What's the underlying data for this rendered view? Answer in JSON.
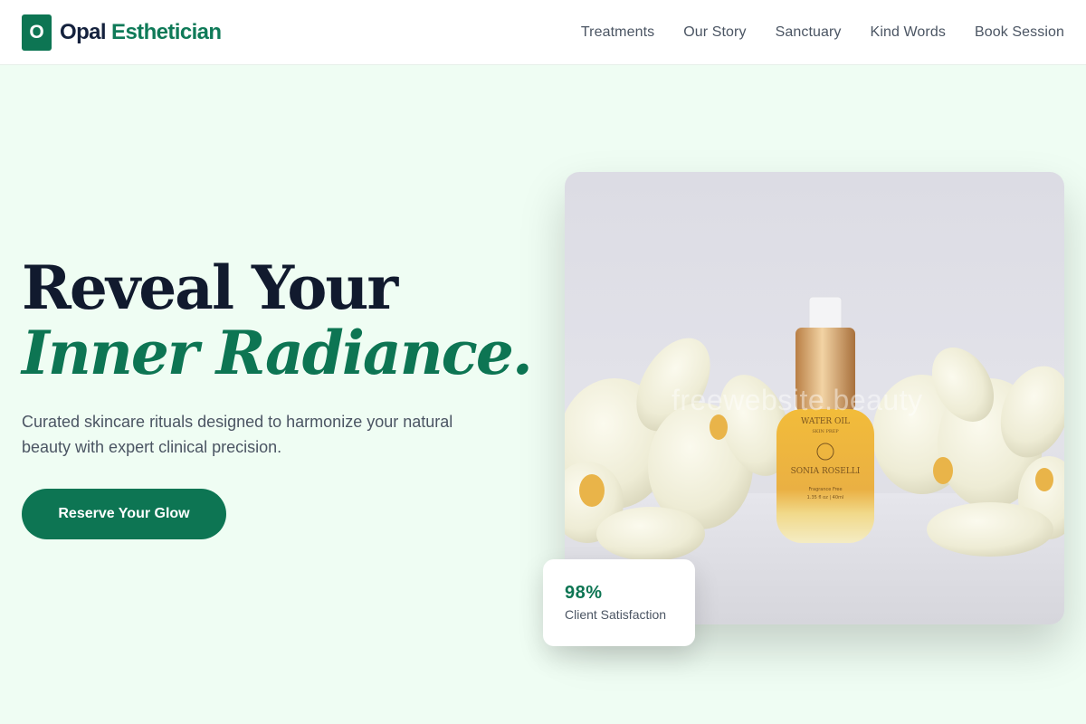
{
  "brand": {
    "logo_letter": "O",
    "name_part1": "Opal",
    "name_part2": "Esthetician"
  },
  "nav": [
    {
      "label": "Treatments"
    },
    {
      "label": "Our Story"
    },
    {
      "label": "Sanctuary"
    },
    {
      "label": "Kind Words"
    },
    {
      "label": "Book Session"
    }
  ],
  "hero": {
    "line1": "Reveal Your",
    "line2": "Inner Radiance.",
    "subtitle": "Curated skincare rituals designed to harmonize your natural beauty with expert clinical precision.",
    "cta_label": "Reserve Your Glow"
  },
  "product_image": {
    "watermark": "freewebsite.beauty",
    "label_line1": "WATER OIL",
    "label_line2": "SKIN PREP",
    "label_brand": "SONIA ROSELLI",
    "label_line3": "Fragrance Free",
    "label_line4": "1.35 fl oz | 40ml"
  },
  "stat": {
    "value": "98%",
    "label": "Client Satisfaction"
  },
  "colors": {
    "accent": "#0d7553",
    "background": "#effdf3",
    "heading": "#111a2e"
  }
}
